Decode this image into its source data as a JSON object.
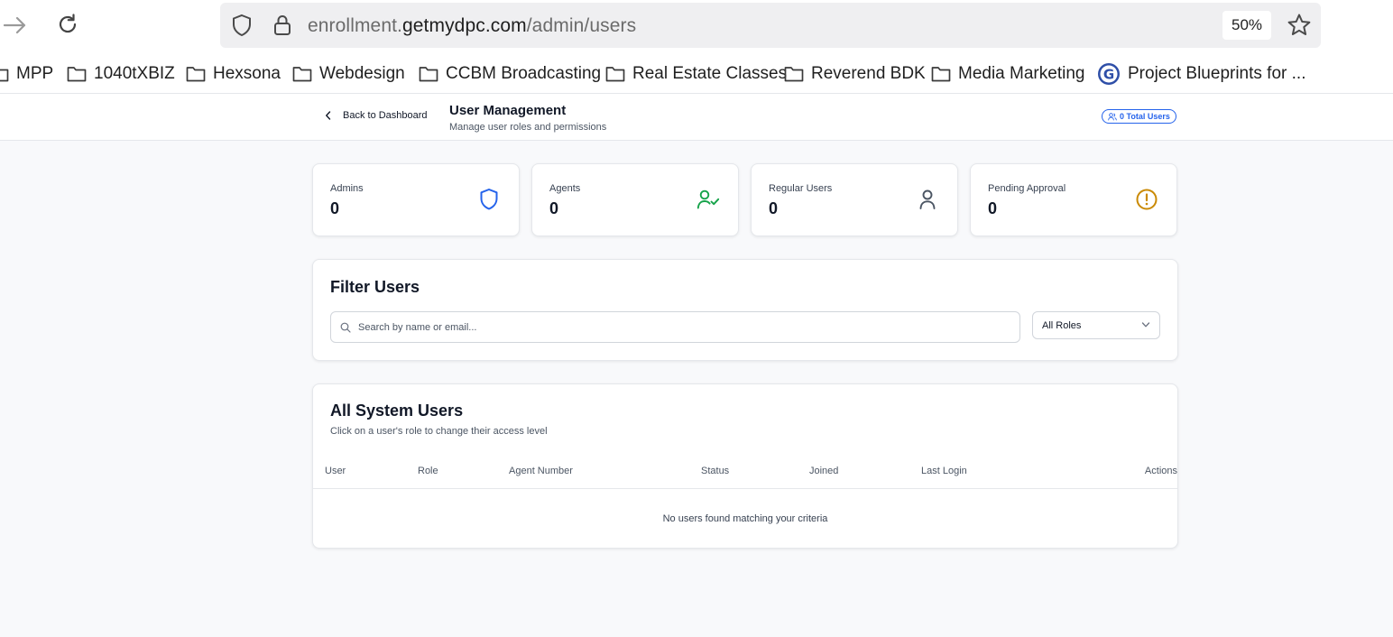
{
  "browser": {
    "url_prefix": "enrollment.",
    "url_domain": "getmydpc.com",
    "url_path": "/admin/users",
    "zoom": "50%",
    "bookmarks": [
      {
        "label": "MPP",
        "icon": "folder-icon"
      },
      {
        "label": "1040tXBIZ",
        "icon": "folder-icon"
      },
      {
        "label": "Hexsona",
        "icon": "folder-icon"
      },
      {
        "label": "Webdesign",
        "icon": "folder-icon"
      },
      {
        "label": "CCBM Broadcasting",
        "icon": "folder-icon"
      },
      {
        "label": "Real Estate Classes",
        "icon": "folder-icon"
      },
      {
        "label": "Reverend BDK",
        "icon": "folder-icon"
      },
      {
        "label": "Media Marketing",
        "icon": "folder-icon"
      },
      {
        "label": "Project Blueprints for ...",
        "icon": "g-logo-icon"
      }
    ]
  },
  "header": {
    "back_label": "Back to Dashboard",
    "title": "User Management",
    "subtitle": "Manage user roles and permissions",
    "total_badge": "0 Total Users"
  },
  "stats": [
    {
      "label": "Admins",
      "value": "0",
      "icon": "shield-icon",
      "color": "#2563eb"
    },
    {
      "label": "Agents",
      "value": "0",
      "icon": "user-check-icon",
      "color": "#16a34a"
    },
    {
      "label": "Regular Users",
      "value": "0",
      "icon": "user-icon",
      "color": "#4b5563"
    },
    {
      "label": "Pending Approval",
      "value": "0",
      "icon": "alert-circle-icon",
      "color": "#ca8a04"
    }
  ],
  "filter": {
    "title": "Filter Users",
    "search_placeholder": "Search by name or email...",
    "search_value": "",
    "role_selected": "All Roles"
  },
  "users_table": {
    "title": "All System Users",
    "description": "Click on a user's role to change their access level",
    "columns": [
      "User",
      "Role",
      "Agent Number",
      "Status",
      "Joined",
      "Last Login",
      "Actions"
    ],
    "rows": [],
    "empty_message": "No users found matching your criteria"
  },
  "colors": {
    "accent": "#2563eb",
    "success": "#16a34a",
    "warning": "#ca8a04",
    "muted": "#4b5563"
  }
}
